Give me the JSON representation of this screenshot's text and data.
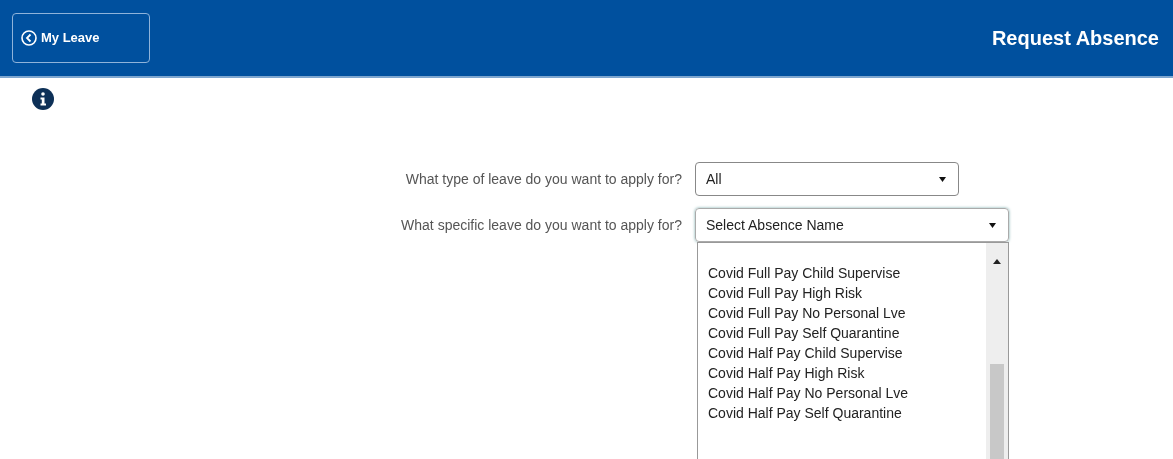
{
  "header": {
    "back_button": "My Leave",
    "title": "Request Absence"
  },
  "form": [
    {
      "label": "What type of leave do you want to apply for?",
      "value": "All",
      "expanded": false
    },
    {
      "label": "What specific leave do you want to apply for?",
      "value": "Select Absence Name",
      "expanded": true
    }
  ],
  "dropdown_options": [
    "Covid Full Pay Child Supervise",
    "Covid Full Pay High Risk",
    "Covid Full Pay No Personal Lve",
    "Covid Full Pay Self Quarantine",
    "Covid Half Pay Child Supervise",
    "Covid Half Pay High Risk",
    "Covid Half Pay No Personal Lve",
    "Covid Half Pay Self Quarantine"
  ]
}
